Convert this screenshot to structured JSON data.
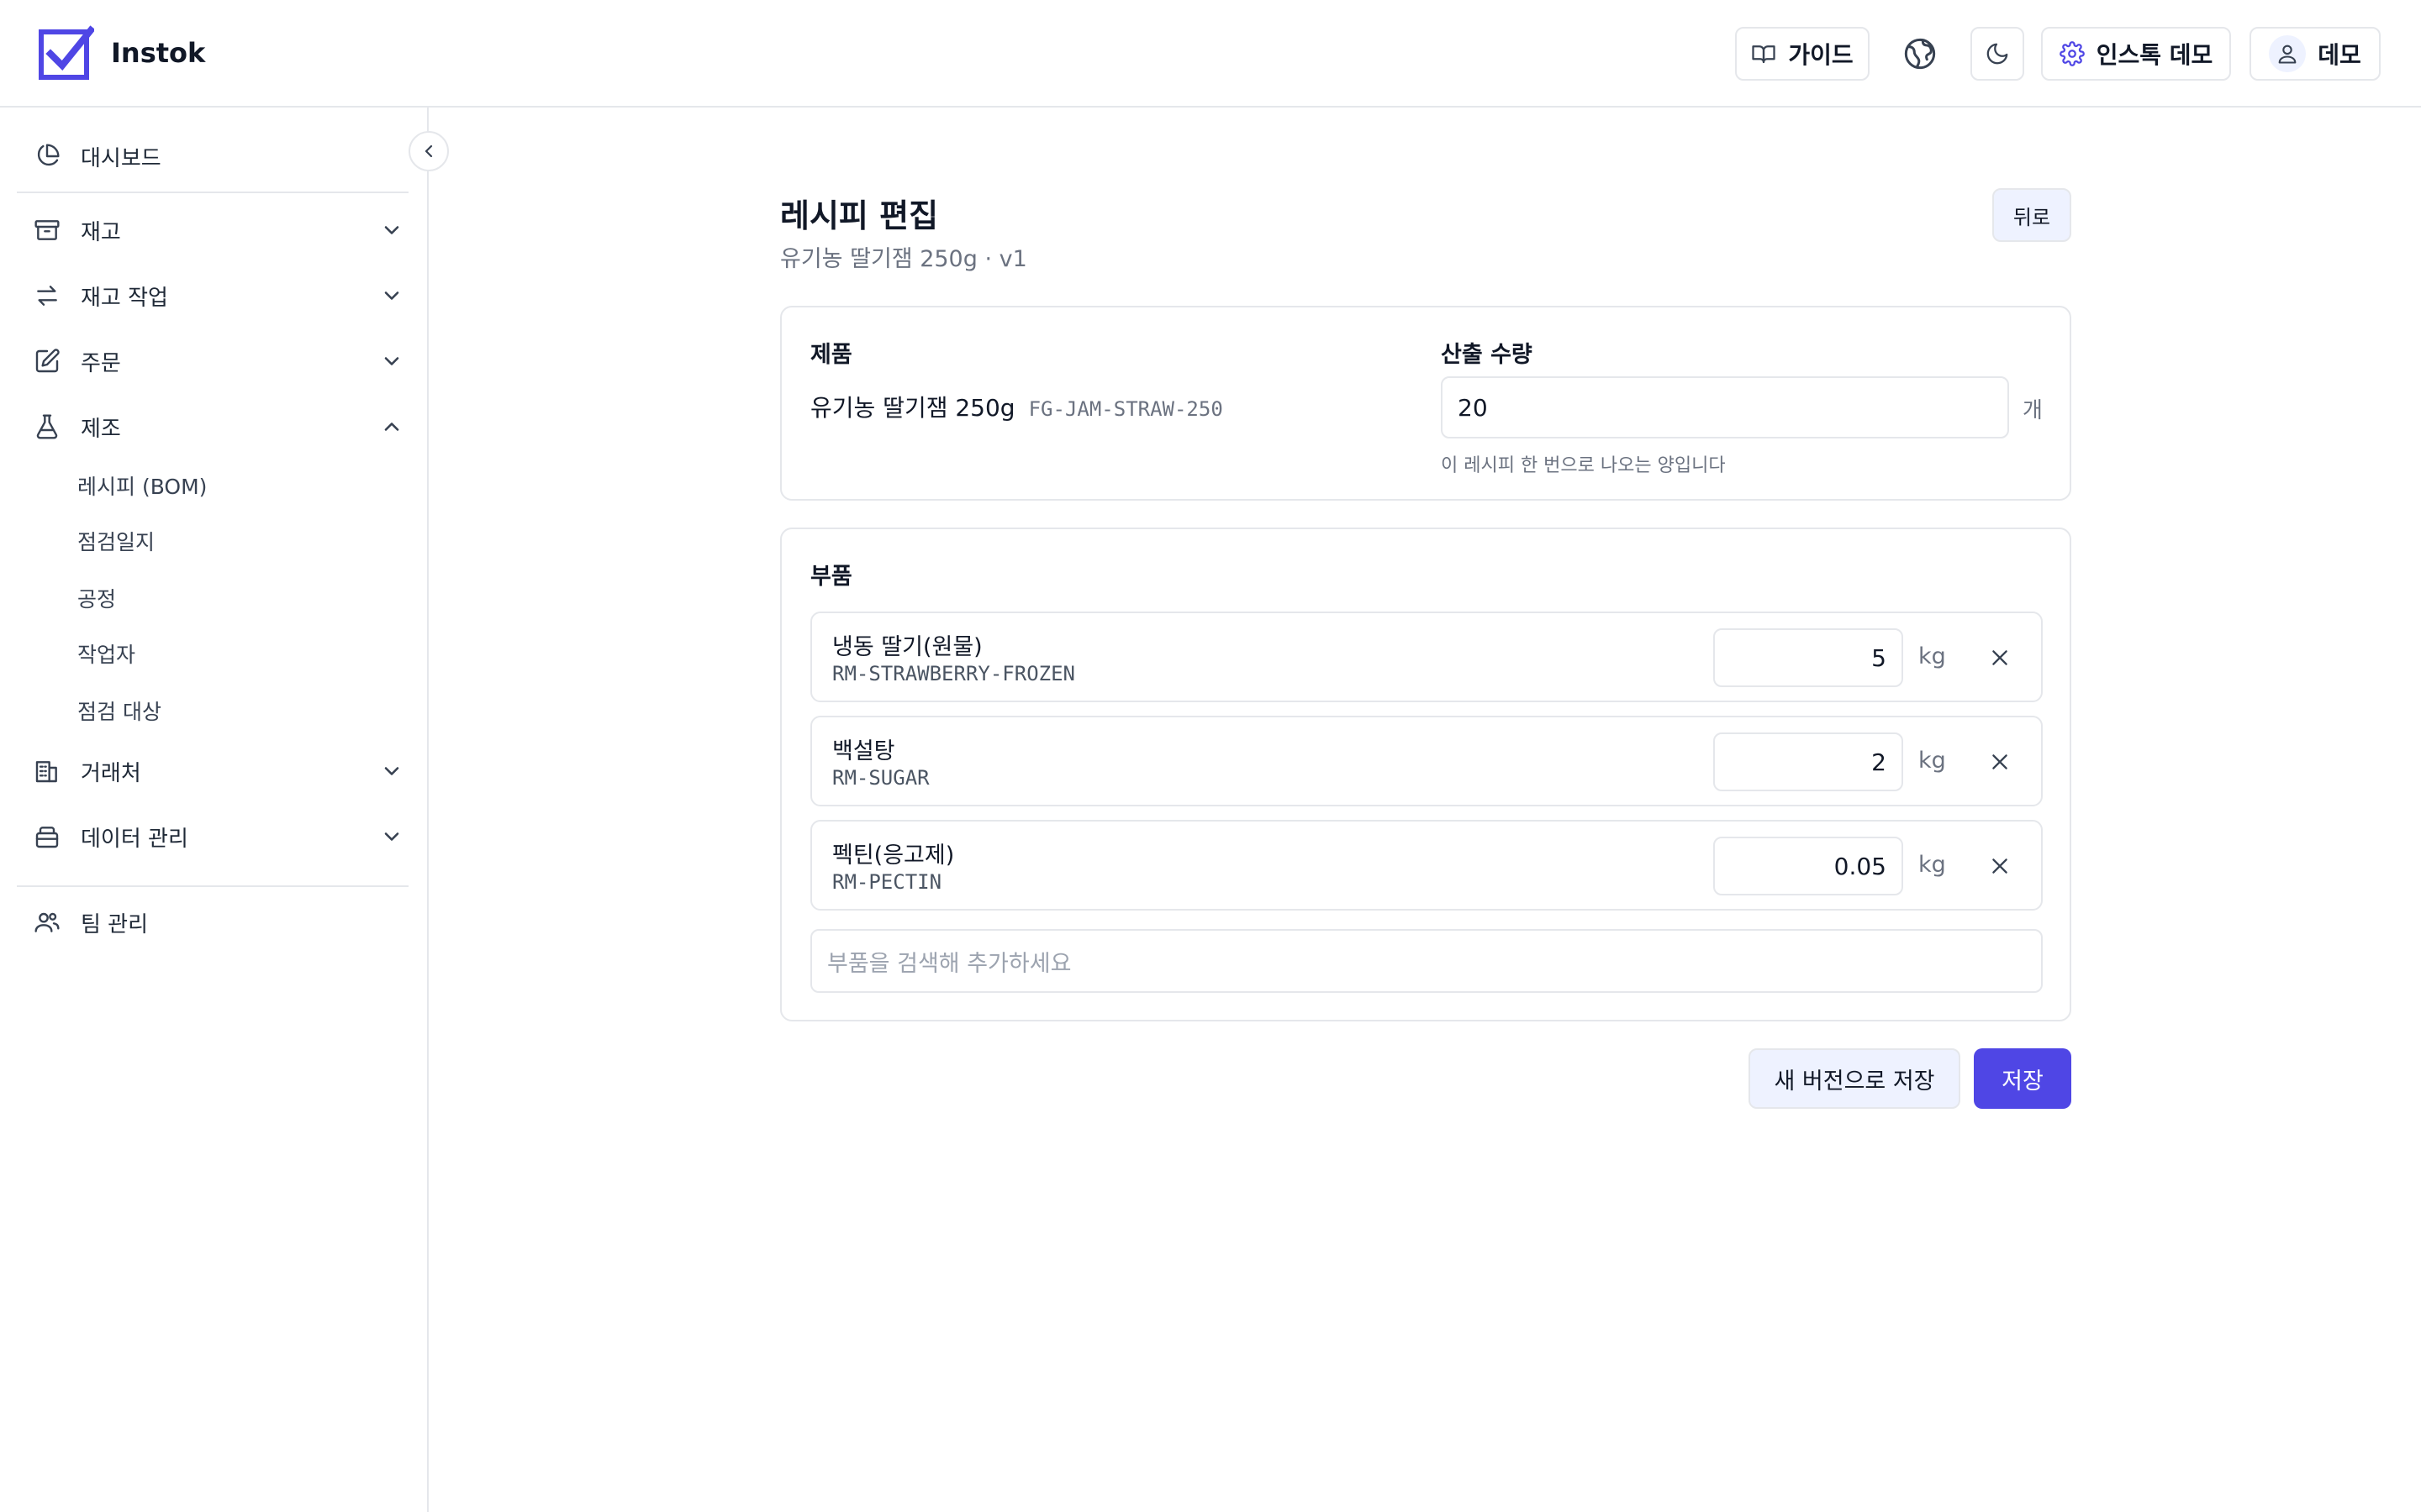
{
  "app": {
    "name": "Instok",
    "accent": "#4f46e5"
  },
  "header": {
    "guide_label": "가이드",
    "settings_label": "인스톡 데모",
    "user_label": "데모"
  },
  "sidebar": {
    "dashboard": "대시보드",
    "inventory": "재고",
    "stock_ops": "재고 작업",
    "orders": "주문",
    "manufacturing": "제조",
    "manufacturing_items": [
      "레시피 (BOM)",
      "점검일지",
      "공정",
      "작업자",
      "점검 대상"
    ],
    "partners": "거래처",
    "data_mgmt": "데이터 관리",
    "team": "팀 관리"
  },
  "main": {
    "title": "레시피 편집",
    "subtitle": "유기농 딸기잼 250g · v1",
    "back_label": "뒤로",
    "product_label": "제품",
    "product_name": "유기농 딸기잼 250g",
    "product_sku": "FG-JAM-STRAW-250",
    "yield_label": "산출 수량",
    "yield_value": "20",
    "yield_unit": "개",
    "yield_hint": "이 레시피 한 번으로 나오는 양입니다",
    "components_label": "부품",
    "components": [
      {
        "name": "냉동 딸기(원물)",
        "sku": "RM-STRAWBERRY-FROZEN",
        "qty": "5",
        "unit": "kg"
      },
      {
        "name": "백설탕",
        "sku": "RM-SUGAR",
        "qty": "2",
        "unit": "kg"
      },
      {
        "name": "펙틴(응고제)",
        "sku": "RM-PECTIN",
        "qty": "0.05",
        "unit": "kg"
      }
    ],
    "search_placeholder": "부품을 검색해 추가하세요",
    "save_new_version_label": "새 버전으로 저장",
    "save_label": "저장"
  }
}
